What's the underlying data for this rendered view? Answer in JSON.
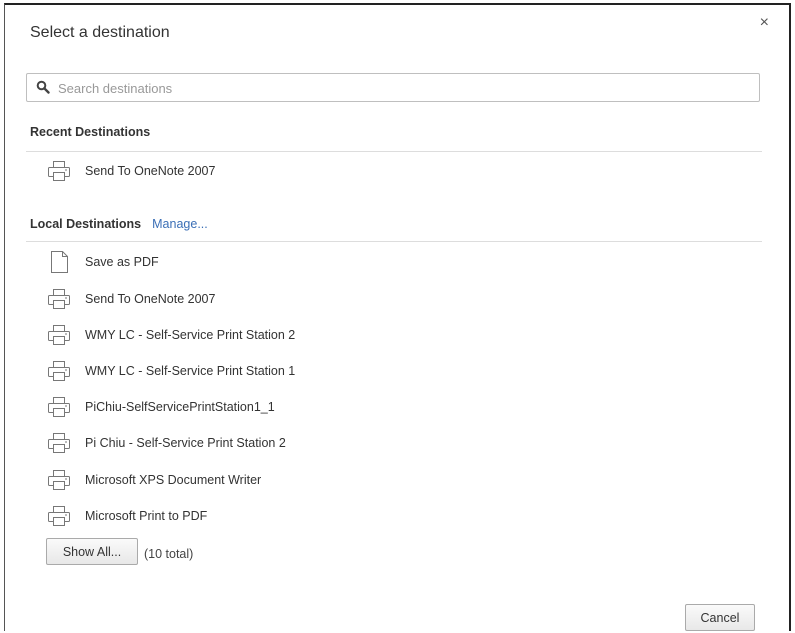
{
  "dialog": {
    "title": "Select a destination",
    "close_glyph": "×"
  },
  "search": {
    "placeholder": "Search destinations",
    "value": ""
  },
  "recent": {
    "heading": "Recent Destinations",
    "items": [
      {
        "label": "Send To OneNote 2007",
        "icon": "printer-icon"
      }
    ]
  },
  "local": {
    "heading": "Local Destinations",
    "manage_label": "Manage...",
    "items": [
      {
        "label": "Save as PDF",
        "icon": "document-icon"
      },
      {
        "label": "Send To OneNote 2007",
        "icon": "printer-icon"
      },
      {
        "label": "WMY LC - Self-Service Print Station 2",
        "icon": "printer-icon"
      },
      {
        "label": "WMY LC - Self-Service Print Station 1",
        "icon": "printer-icon"
      },
      {
        "label": "PiChiu-SelfServicePrintStation1_1",
        "icon": "printer-icon"
      },
      {
        "label": "Pi Chiu - Self-Service Print Station 2",
        "icon": "printer-icon"
      },
      {
        "label": "Microsoft XPS Document Writer",
        "icon": "printer-icon"
      },
      {
        "label": "Microsoft Print to PDF",
        "icon": "printer-icon"
      }
    ]
  },
  "footer": {
    "show_all_label": "Show All...",
    "total_text": "(10 total)",
    "cancel_label": "Cancel"
  }
}
